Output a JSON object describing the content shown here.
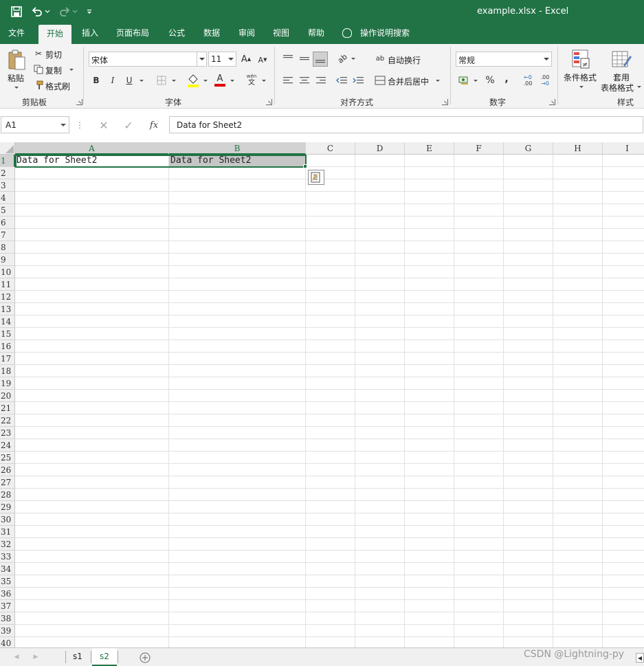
{
  "window": {
    "title": "example.xlsx  -  Excel"
  },
  "ribbon_tabs": [
    "文件",
    "开始",
    "插入",
    "页面布局",
    "公式",
    "数据",
    "审阅",
    "视图",
    "帮助"
  ],
  "active_tab": "开始",
  "tell_me": "操作说明搜索",
  "clipboard": {
    "paste": "粘贴",
    "cut": "剪切",
    "copy": "复制",
    "format_painter": "格式刷",
    "group": "剪贴板"
  },
  "font": {
    "name": "宋体",
    "size": "11",
    "grow": "A",
    "shrink": "A",
    "bold": "B",
    "italic": "I",
    "underline": "U",
    "font_color": "A",
    "phonetic_top": "wén",
    "phonetic_bottom": "文",
    "group": "字体"
  },
  "alignment": {
    "wrap_text": "自动换行",
    "merge_center": "合并后居中",
    "group": "对齐方式"
  },
  "number": {
    "format": "常规",
    "percent": "%",
    "comma": ",",
    "inc_decimal_a": "←0",
    "inc_decimal_b": ".00",
    "dec_decimal_a": ".00",
    "dec_decimal_b": "→0",
    "group": "数字"
  },
  "styles": {
    "conditional": "条件格式",
    "table_line1": "套用",
    "table_line2": "表格格式",
    "group": "样式"
  },
  "formula_bar": {
    "name_box": "A1",
    "fx": "fx",
    "content": "Data for Sheet2"
  },
  "columns": [
    "A",
    "B",
    "C",
    "D",
    "E",
    "F",
    "G",
    "H",
    "I"
  ],
  "rows": [
    "1",
    "2",
    "3",
    "4",
    "5",
    "6",
    "7",
    "8",
    "9",
    "10",
    "11",
    "12",
    "13",
    "14",
    "15",
    "16",
    "17",
    "18",
    "19",
    "20",
    "21",
    "22",
    "23",
    "24",
    "25",
    "26",
    "27",
    "28",
    "29",
    "30",
    "31",
    "32",
    "33",
    "34",
    "35",
    "36",
    "37",
    "38",
    "39",
    "40"
  ],
  "cells": {
    "A1": "Data for Sheet2",
    "B1": "Data for Sheet2"
  },
  "sheets": [
    "s1",
    "s2"
  ],
  "active_sheet": "s2",
  "watermark": "CSDN @Lightning-py",
  "colors": {
    "excel_green": "#217346",
    "selected_fill": "#c6c6c6",
    "header_bg": "#efefef"
  }
}
